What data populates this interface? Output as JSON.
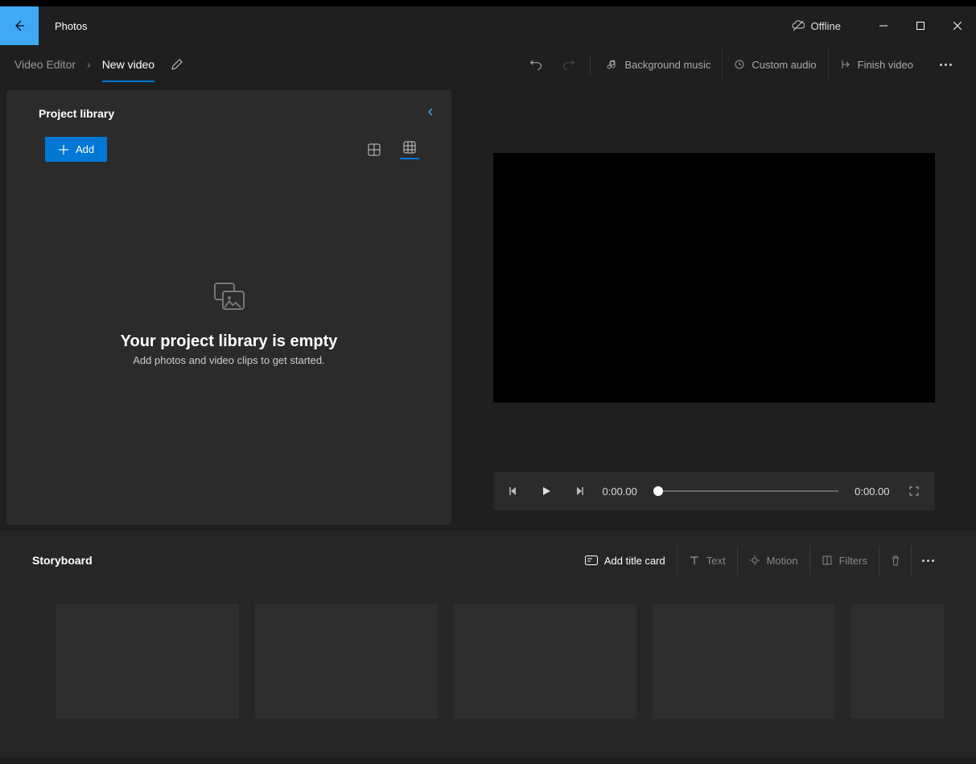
{
  "titlebar": {
    "app_name": "Photos",
    "offline_label": "Offline"
  },
  "breadcrumb": {
    "root": "Video Editor",
    "current": "New video"
  },
  "toolbar": {
    "bg_music": "Background music",
    "custom_audio": "Custom audio",
    "finish": "Finish video"
  },
  "library": {
    "title": "Project library",
    "add_label": "Add",
    "empty_title": "Your project library is empty",
    "empty_sub": "Add photos and video clips to get started."
  },
  "player": {
    "current_time": "0:00.00",
    "total_time": "0:00.00"
  },
  "storyboard": {
    "title": "Storyboard",
    "add_title_card": "Add title card",
    "text": "Text",
    "motion": "Motion",
    "filters": "Filters"
  }
}
